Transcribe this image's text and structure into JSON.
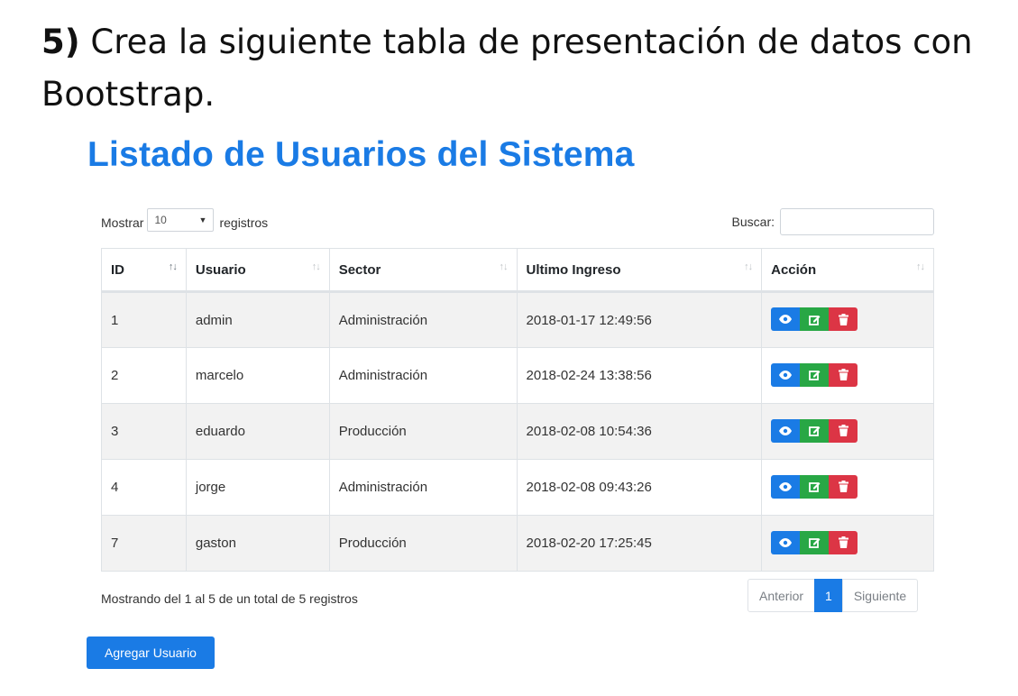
{
  "exercise": {
    "number": "5)",
    "text": " Crea la siguiente tabla de presentación de datos con Bootstrap."
  },
  "page_title": "Listado de Usuarios del Sistema",
  "length_control": {
    "prefix": "Mostrar",
    "selected": "10",
    "suffix": "registros"
  },
  "search": {
    "label": "Buscar:",
    "value": ""
  },
  "table": {
    "columns": [
      "ID",
      "Usuario",
      "Sector",
      "Ultimo Ingreso",
      "Acción"
    ],
    "sort_icon": "sort-arrows-icon",
    "rows": [
      {
        "id": "1",
        "usuario": "admin",
        "sector": "Administración",
        "ultimo_ingreso": "2018-01-17 12:49:56"
      },
      {
        "id": "2",
        "usuario": "marcelo",
        "sector": "Administración",
        "ultimo_ingreso": "2018-02-24 13:38:56"
      },
      {
        "id": "3",
        "usuario": "eduardo",
        "sector": "Producción",
        "ultimo_ingreso": "2018-02-08 10:54:36"
      },
      {
        "id": "4",
        "usuario": "jorge",
        "sector": "Administración",
        "ultimo_ingreso": "2018-02-08 09:43:26"
      },
      {
        "id": "7",
        "usuario": "gaston",
        "sector": "Producción",
        "ultimo_ingreso": "2018-02-20 17:25:45"
      }
    ],
    "action_icons": [
      "eye-icon",
      "edit-icon",
      "trash-icon"
    ]
  },
  "info_text": "Mostrando del 1 al 5 de un total de 5 registros",
  "pagination": {
    "previous": "Anterior",
    "current": "1",
    "next": "Siguiente"
  },
  "add_button": "Agregar Usuario",
  "colors": {
    "primary": "#1a7be5",
    "success": "#28a745",
    "danger": "#dc3545",
    "stripe": "#f2f2f2"
  }
}
